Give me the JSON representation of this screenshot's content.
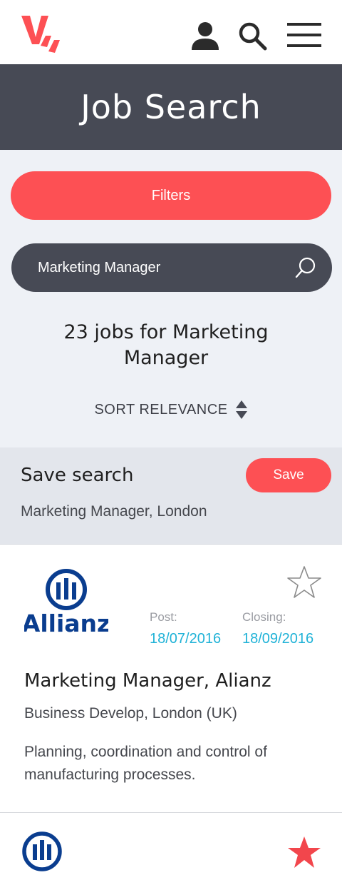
{
  "header": {
    "logo_icon": "brand-v-logo-icon",
    "brand_color": "#fd5054",
    "user_icon": "user-icon",
    "search_icon": "search-icon",
    "menu_icon": "hamburger-menu-icon"
  },
  "banner": {
    "title": "Job Search",
    "bg_color": "#474a55"
  },
  "search": {
    "filters_label": "Filters",
    "query_value": "Marketing Manager",
    "results_text": "23 jobs for Marketing Manager",
    "sort_label": "SORT RELEVANCE"
  },
  "save_search": {
    "title": "Save search",
    "save_label": "Save",
    "query": "Marketing Manager, London"
  },
  "jobs": [
    {
      "company": "Allianz",
      "post_label": "Post:",
      "post_date": "18/07/2016",
      "closing_label": "Closing:",
      "closing_date": "18/09/2016",
      "title": "Marketing Manager, Alianz",
      "subtitle": "Business Develop, London (UK)",
      "description": "Planning, coordination and control of manufacturing processes.",
      "favorite": false
    },
    {
      "favorite": true
    }
  ],
  "colors": {
    "accent": "#fd5054",
    "date": "#1fb2d7",
    "allianz_blue": "#0a3d8f"
  }
}
